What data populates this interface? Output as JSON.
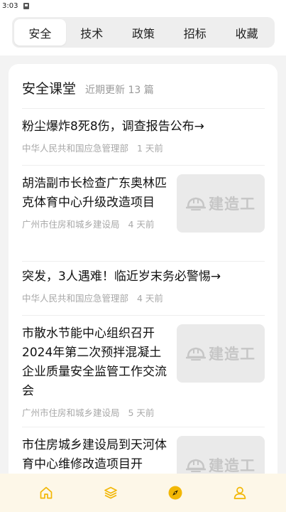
{
  "status_bar": {
    "time": "3:03"
  },
  "tabs": [
    {
      "label": "安全",
      "active": true
    },
    {
      "label": "技术",
      "active": false
    },
    {
      "label": "政策",
      "active": false
    },
    {
      "label": "招标",
      "active": false
    },
    {
      "label": "收藏",
      "active": false
    }
  ],
  "section": {
    "title": "安全课堂",
    "subtitle": "近期更新 13 篇"
  },
  "news": [
    {
      "title": "粉尘爆炸8死8伤，调查报告公布→",
      "source": "中华人民共和国应急管理部",
      "time": "1 天前",
      "thumb": false
    },
    {
      "title": "胡浩副市长检查广东奥林匹克体育中心升级改造项目",
      "source": "广州市住房和城乡建设局",
      "time": "4 天前",
      "thumb": true
    },
    {
      "title": "突发，3人遇难！临近岁末务必警惕→",
      "source": "中华人民共和国应急管理部",
      "time": "4 天前",
      "thumb": false
    },
    {
      "title": "市散水节能中心组织召开2024年第二次预拌混凝土企业质量安全监管工作交流会",
      "source": "广州市住房和城乡建设局",
      "time": "5 天前",
      "thumb": true
    },
    {
      "title": "市住房城乡建设局到天河体育中心维修改造项目开",
      "source": "",
      "time": "",
      "thumb": true
    }
  ],
  "thumb_logo_text": "建造工",
  "colors": {
    "accent": "#f2b705",
    "nav_bg": "#fdf7e8"
  },
  "bottom_nav": [
    {
      "icon": "home-icon"
    },
    {
      "icon": "layers-icon"
    },
    {
      "icon": "compass-icon",
      "active": true
    },
    {
      "icon": "user-icon"
    }
  ]
}
